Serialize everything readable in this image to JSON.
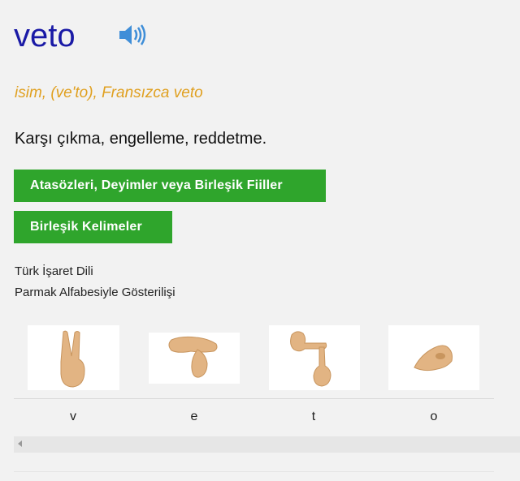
{
  "entry": {
    "word": "veto",
    "audio_icon": "speaker-icon",
    "pos_line": "isim, (ve'to), Fransızca veto",
    "definition": "Karşı çıkma, engelleme, reddetme."
  },
  "buttons": {
    "idioms": "Atasözleri, Deyimler veya Birleşik Fiiller",
    "compounds": "Birleşik Kelimeler"
  },
  "sign_language": {
    "title_line1": "Türk İşaret Dili",
    "title_line2": "Parmak Alfabesiyle Gösterilişi",
    "letters": [
      "v",
      "e",
      "t",
      "o"
    ]
  },
  "colors": {
    "word": "#1a1aa6",
    "pos": "#e0a020",
    "button_bg": "#2fa52c",
    "speaker": "#3f8ed8",
    "skin": "#e2b483"
  }
}
